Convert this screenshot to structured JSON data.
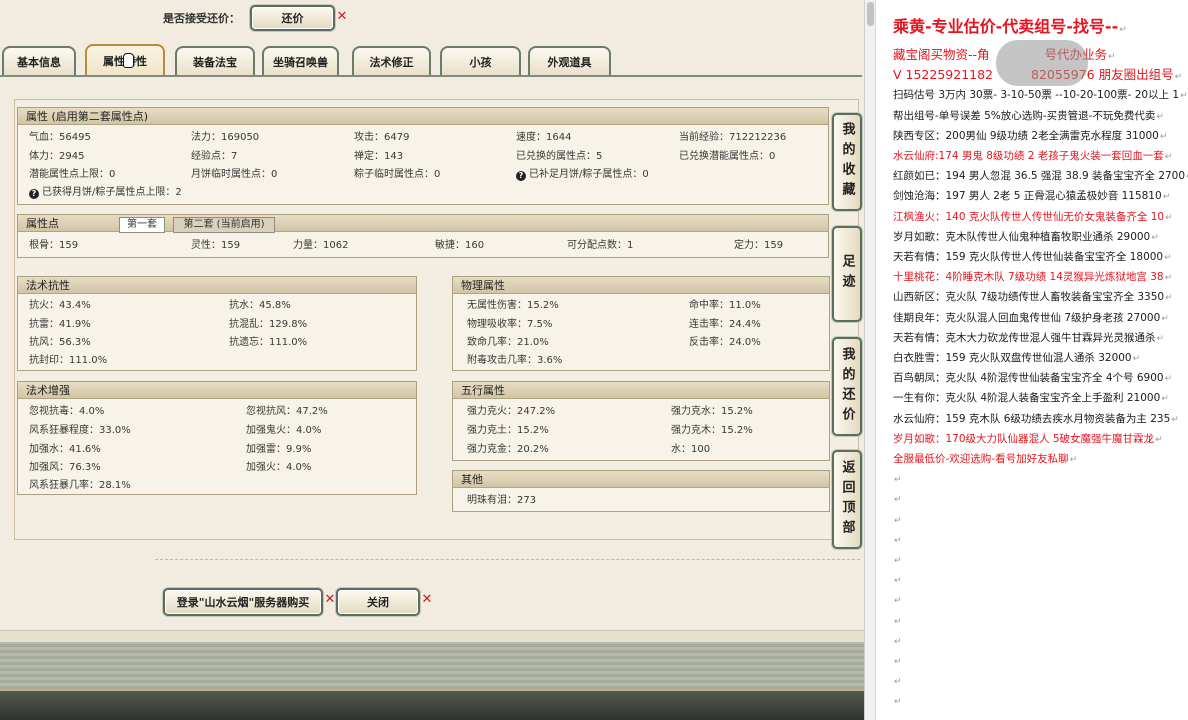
{
  "offer": {
    "label": "是否接受还价：",
    "button": "还价"
  },
  "tabs": [
    {
      "label": "基本信息"
    },
    {
      "label": "属性特性",
      "active": true
    },
    {
      "label": "装备法宝"
    },
    {
      "label": "坐骑召唤兽"
    },
    {
      "label": "法术修正"
    },
    {
      "label": "小孩"
    },
    {
      "label": "外观道具"
    }
  ],
  "side_buttons": [
    "我的收藏",
    "足迹",
    "我的还价",
    "返回顶部"
  ],
  "attributes": {
    "title": "属性 (启用第二套属性点)",
    "rows": [
      [
        {
          "t": "气血：56495"
        },
        {
          "t": "法力：169050"
        },
        {
          "t": "攻击：6479"
        },
        {
          "t": "速度：1644"
        },
        {
          "t": "当前经验：712212236"
        }
      ],
      [
        {
          "t": "体力：2945"
        },
        {
          "t": "经验点：7"
        },
        {
          "t": "禅定：143"
        },
        {
          "t": "已兑换的属性点：5"
        },
        {
          "t": "已兑换潜能属性点：0"
        }
      ],
      [
        {
          "t": "潜能属性点上限：0"
        },
        {
          "t": "月饼临时属性点：0"
        },
        {
          "t": "粽子临时属性点：0"
        },
        {
          "t": "已补足月饼/粽子属性点：0",
          "help": true
        }
      ],
      [
        {
          "t": "已获得月饼/粽子属性点上限：2",
          "help": true
        }
      ]
    ]
  },
  "attr_points": {
    "title": "属性点",
    "tabs": [
      "第一套",
      "第二套 (当前启用)"
    ],
    "selected_tab": 0,
    "values": [
      "根骨：159",
      "灵性：159",
      "力量：1062",
      "敏捷：160",
      "可分配点数：1",
      "定力：159"
    ]
  },
  "spell_resist": {
    "title": "法术抗性",
    "rows": [
      [
        "抗火：43.4%",
        "抗水：45.8%"
      ],
      [
        "抗雷：41.9%",
        "抗混乱：129.8%"
      ],
      [
        "抗风：56.3%",
        "抗遗忘：111.0%"
      ],
      [
        "抗封印：111.0%"
      ]
    ]
  },
  "physical": {
    "title": "物理属性",
    "rows": [
      [
        "无属性伤害：15.2%",
        "命中率：11.0%"
      ],
      [
        "物理吸收率：7.5%",
        "连击率：24.4%"
      ],
      [
        "致命几率：21.0%",
        "反击率：24.0%"
      ],
      [
        "附毒攻击几率：3.6%"
      ]
    ]
  },
  "spell_enhance": {
    "title": "法术增强",
    "rows": [
      [
        "忽视抗毒：4.0%",
        "忽视抗风：47.2%"
      ],
      [
        "风系狂暴程度：33.0%",
        "加强鬼火：4.0%"
      ],
      [
        "加强水：41.6%",
        "加强雷：9.9%"
      ],
      [
        "加强风：76.3%",
        "加强火：4.0%"
      ],
      [
        "风系狂暴几率：28.1%"
      ]
    ]
  },
  "five_elements": {
    "title": "五行属性",
    "rows": [
      [
        "强力克火：247.2%",
        "强力克水：15.2%"
      ],
      [
        "强力克土：15.2%",
        "强力克木：15.2%"
      ],
      [
        "强力克金：20.2%",
        "水：100"
      ]
    ]
  },
  "other": {
    "title": "其他",
    "rows": [
      [
        "明珠有泪：273"
      ]
    ]
  },
  "bottom_buttons": {
    "buy": "登录\"山水云烟\"服务器购买",
    "close": "关闭"
  },
  "document": {
    "title": "乘黄-专业估价-代卖组号-找号--",
    "lines": [
      {
        "parts": [
          "藏宝阁买物资--角",
          "号代办业务"
        ],
        "color": "red",
        "large": true
      },
      {
        "parts": [
          "V 15225921182",
          "82055976 朋友圈出组号"
        ],
        "color": "red",
        "large": true
      },
      {
        "parts": [
          "扫码估号 3万内 30票- 3-10-50票 --10-20-100票- 20以上 1"
        ]
      },
      {
        "parts": [
          "帮出组号-单号误差 5%放心选购-买贵管退-不玩免费代卖"
        ]
      },
      {
        "parts": [
          "陕西专区：200男仙 9级功绩 2老全满雷克水程度 31000"
        ]
      },
      {
        "parts": [
          "水云仙府:174 男鬼 8级功绩 2 老孩子鬼火装一套回血一套"
        ],
        "color": "red"
      },
      {
        "parts": [
          "红颜如已：194 男人忽混 36.5 强混 38.9 装备宝宝齐全 2700"
        ]
      },
      {
        "parts": [
          "剑蚀沧海：197 男人 2老 5 正骨混心猿孟极妙音 115810"
        ]
      },
      {
        "parts": [
          "江枫渔火：140 克火队传世人传世仙无价女鬼装备齐全 10"
        ],
        "color": "red"
      },
      {
        "parts": [
          "岁月如歌：克木队传世人仙鬼种植畜牧职业通杀 29000"
        ]
      },
      {
        "parts": [
          "天若有情：159 克火队传世人传世仙装备宝宝齐全 18000"
        ]
      },
      {
        "parts": [
          "十里桃花：4阶睡克木队 7级功绩 14灵猴异光炼狱地宫 38"
        ],
        "color": "red"
      },
      {
        "parts": [
          "山西新区：克火队 7级功绩传世人畜牧装备宝宝齐全 3350"
        ]
      },
      {
        "parts": [
          "佳期良年：克火队混人回血鬼传世仙 7级护身老孩 27000"
        ]
      },
      {
        "parts": [
          "天若有情：克木大力砍龙传世混人强牛甘霖异光灵猴通杀"
        ]
      },
      {
        "parts": [
          "白衣胜雪：159 克火队双盘传世仙混人通杀 32000"
        ]
      },
      {
        "parts": [
          "百鸟朝凤：克火队 4阶混传世仙装备宝宝齐全 4个号 6900"
        ]
      },
      {
        "parts": [
          "一生有你：克火队 4阶混人装备宝宝齐全上手盈利 21000"
        ]
      },
      {
        "parts": [
          "水云仙府：159 克木队 6级功绩去疾水月物资装备为主 235"
        ]
      },
      {
        "parts": [
          "岁月如歌：170级大力队仙器混人 5破女魔强牛魔甘霖龙"
        ],
        "color": "red"
      },
      {
        "parts": [
          "全服最低价-欢迎选购-看号加好友私聊"
        ],
        "color": "red"
      }
    ]
  },
  "icons": {
    "dismiss": "red-x-icon",
    "help": "help-icon",
    "cursor": "hand-cursor-icon",
    "paragraph_mark": "return-mark-icon"
  },
  "colors": {
    "document_red": "#e5151e",
    "active_tab_border": "#b88a3c",
    "panel_background": "#f1ecdf",
    "button_border": "#5d6c5f"
  }
}
